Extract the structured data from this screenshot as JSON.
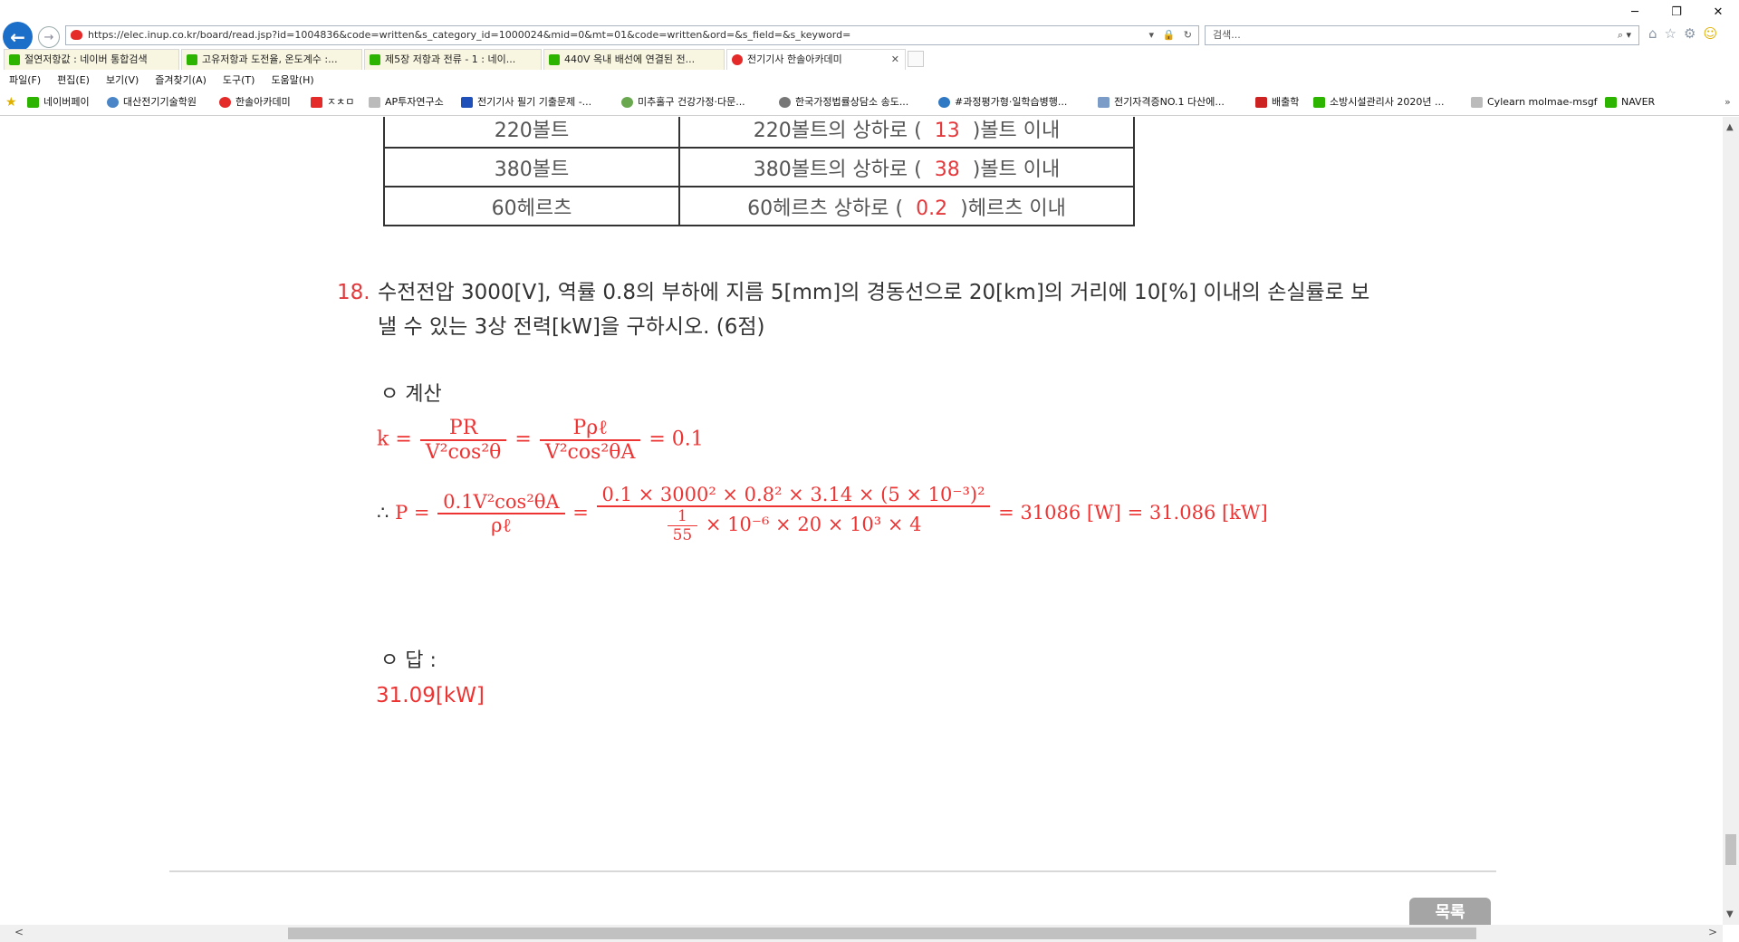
{
  "browser": {
    "url": "https://elec.inup.co.kr/board/read.jsp?id=1004836&code=written&s_category_id=1000024&mid=0&mt=01&code=written&ord=&s_field=&s_keyword=",
    "search_placeholder": "검색...",
    "window_controls": [
      "─",
      "❐",
      "✕"
    ],
    "tabs": [
      {
        "label": "절연저항값 : 네이버 통합검색",
        "icon_color": "#2db400"
      },
      {
        "label": "고유저항과 도전율, 온도계수 :...",
        "icon_color": "#2db400"
      },
      {
        "label": "제5장 저항과 전류 - 1 : 네이...",
        "icon_color": "#2db400"
      },
      {
        "label": "440V 옥내 배선에 연결된 전...",
        "icon_color": "#2db400"
      },
      {
        "label": "전기기사 한솔아카데미",
        "icon_color": "#e52a2a"
      }
    ],
    "menu": [
      "파일(F)",
      "편집(E)",
      "보기(V)",
      "즐겨찾기(A)",
      "도구(T)",
      "도움말(H)"
    ],
    "favorites": [
      {
        "label": "네이버페이",
        "icon_color": "#2db400"
      },
      {
        "label": "대산전기기술학원",
        "icon_color": "#4a86c7"
      },
      {
        "label": "한솔아카데미",
        "icon_color": "#e52a2a"
      },
      {
        "label": "ㅈㅊㅁ",
        "icon_color": "#e52a2a"
      },
      {
        "label": "AP투자연구소",
        "icon_color": "#888888"
      },
      {
        "label": "전기기사 필기 기출문제 -...",
        "icon_color": "#1f4fb8"
      },
      {
        "label": "미추홀구 건강가정·다문...",
        "icon_color": "#6aa84f"
      },
      {
        "label": "한국가정법률상담소 송도...",
        "icon_color": "#555555"
      },
      {
        "label": "#과정평가형·일학습병행...",
        "icon_color": "#2f78c4"
      },
      {
        "label": "전기자격증NO.1 다산에...",
        "icon_color": "#7a9cc6"
      },
      {
        "label": "배출학",
        "icon_color": "#cc2222"
      },
      {
        "label": "소방시설관리사 2020년 ...",
        "icon_color": "#2db400"
      },
      {
        "label": "Cylearn molmae-msgf",
        "icon_color": "#888888"
      },
      {
        "label": "NAVER",
        "icon_color": "#2db400"
      }
    ]
  },
  "table": {
    "rows": [
      {
        "left": "220볼트",
        "right_pre": "220볼트의 상하로 (",
        "value": "13",
        "right_post": ")볼트 이내"
      },
      {
        "left": "380볼트",
        "right_pre": "380볼트의 상하로 (",
        "value": "38",
        "right_post": ")볼트 이내"
      },
      {
        "left": "60헤르츠",
        "right_pre": "60헤르츠 상하로 (",
        "value": "0.2",
        "right_post": ")헤르츠 이내"
      }
    ]
  },
  "question": {
    "number": "18.",
    "text": "수전전압 3000[V], 역률 0.8의 부하에 지름 5[mm]의 경동선으로 20[km]의 거리에 10[%] 이내의 손실률로 보낼 수 있는 3상 전력[kW]을 구하시오. (6점)"
  },
  "calc": {
    "heading": "ㅇ 계산",
    "line1": {
      "k": "k =",
      "n1": "PR",
      "d1": "V²cos²θ",
      "eq": "=",
      "n2": "Pρℓ",
      "d2": "V²cos²θA",
      "result": "= 0.1"
    },
    "line2": {
      "therefore": "∴",
      "p": "P =",
      "n1": "0.1V²cos²θA",
      "d1": "ρℓ",
      "eq": "=",
      "n2": "0.1 × 3000² × 0.8² × 3.14 × (5 × 10⁻³)²",
      "d2_frac_n": "1",
      "d2_frac_d": "55",
      "d2_rest": "× 10⁻⁶ × 20 × 10³ × 4",
      "result": "= 31086 [W] = 31.086 [kW]"
    }
  },
  "answer": {
    "heading": "ㅇ 답 :",
    "value": "31.09[kW]"
  },
  "list_button": "목록",
  "colors": {
    "accent": "#e3393c",
    "nav_blue": "#1b6fc9"
  }
}
